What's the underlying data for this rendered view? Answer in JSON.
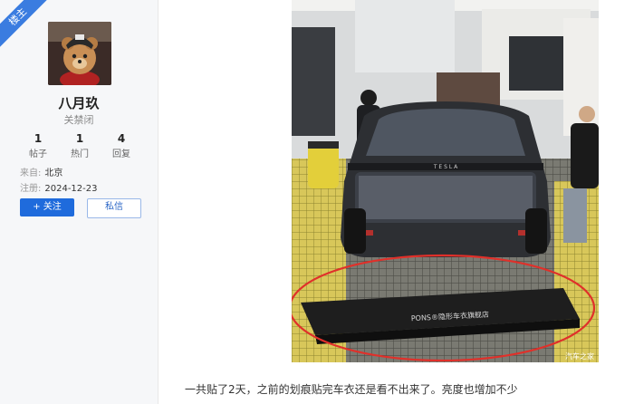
{
  "badge": "楼主",
  "user": {
    "name": "八月玖",
    "tag": "关禁闭",
    "stats": [
      {
        "value": "1",
        "label": "帖子"
      },
      {
        "value": "1",
        "label": "热门"
      },
      {
        "value": "4",
        "label": "回复"
      }
    ],
    "from_label": "来自:",
    "from_value": "北京",
    "reg_label": "注册:",
    "reg_value": "2024-12-23"
  },
  "actions": {
    "follow": "+ 关注",
    "message": "私信"
  },
  "photo": {
    "brand_text": "T E S L A",
    "box_text": "PONS®隐形车衣旗舰店",
    "watermark": "汽车之家"
  },
  "post": {
    "caption": "一共贴了2天，之前的划痕贴完车衣还是看不出来了。亮度也增加不少"
  },
  "colors": {
    "accent": "#1f6bdc",
    "badge": "#3a7ce0",
    "circle": "#e0302a"
  }
}
